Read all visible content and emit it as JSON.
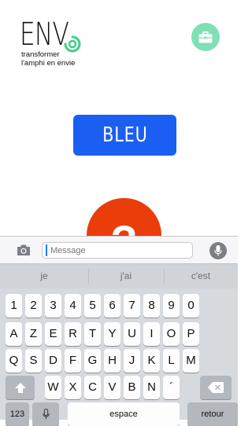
{
  "app": {
    "logo_text": "ENV",
    "tagline_line1": "transformer",
    "tagline_line2": "l'amphi en envie",
    "color_button": "BLEU",
    "question_mark": "?",
    "colors": {
      "blue": "#1a5ff2",
      "mint": "#7fe0b5",
      "orange": "#ea3d0a",
      "logo_green": "#3bd083"
    },
    "icons": [
      "briefcase-icon",
      "logo-swirl-icon"
    ]
  },
  "keyboard": {
    "message_placeholder": "Message",
    "suggestions": [
      "je",
      "j'ai",
      "c'est"
    ],
    "row_numbers": [
      "1",
      "2",
      "3",
      "4",
      "5",
      "6",
      "7",
      "8",
      "9",
      "0"
    ],
    "row_azerty": [
      "A",
      "Z",
      "E",
      "R",
      "T",
      "Y",
      "U",
      "I",
      "O",
      "P"
    ],
    "row_qsdf": [
      "Q",
      "S",
      "D",
      "F",
      "G",
      "H",
      "J",
      "K",
      "L",
      "M"
    ],
    "row_wxcv": [
      "W",
      "X",
      "C",
      "V",
      "B",
      "N",
      "´"
    ],
    "numbers_key": "123",
    "space_key": "espace",
    "return_key": "retour",
    "icons": [
      "camera-icon",
      "microphone-icon",
      "shift-icon",
      "backspace-icon",
      "dictation-icon"
    ]
  }
}
